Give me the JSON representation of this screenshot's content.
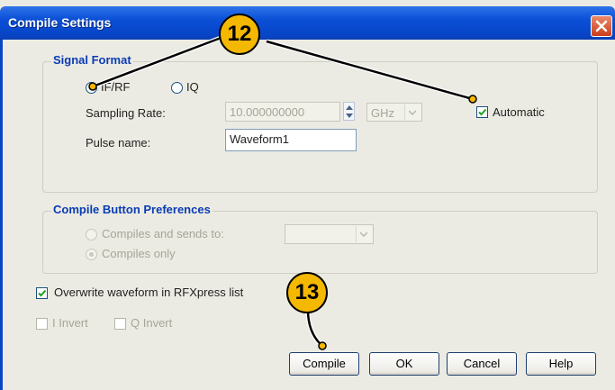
{
  "window": {
    "title": "Compile Settings"
  },
  "signal_format": {
    "legend": "Signal Format",
    "radio_ifrf": "IF/RF",
    "radio_iq": "IQ",
    "sampling_rate_label": "Sampling Rate:",
    "sampling_rate_value": "10.000000000",
    "sampling_rate_unit": "GHz",
    "automatic_label": "Automatic",
    "pulse_name_label": "Pulse name:",
    "pulse_name_value": "Waveform1"
  },
  "compile_prefs": {
    "legend": "Compile Button Preferences",
    "option_send": "Compiles and sends to:",
    "option_only": "Compiles only"
  },
  "options": {
    "overwrite_label": "Overwrite waveform in RFXpress list",
    "i_invert": "I Invert",
    "q_invert": "Q Invert"
  },
  "buttons": {
    "compile": "Compile",
    "ok": "OK",
    "cancel": "Cancel",
    "help": "Help"
  },
  "callouts": {
    "first": "12",
    "second": "13"
  },
  "colors": {
    "title_bar": "#0a4fd6",
    "legend_text": "#0a3cb5",
    "callout_fill": "#f5b800"
  }
}
